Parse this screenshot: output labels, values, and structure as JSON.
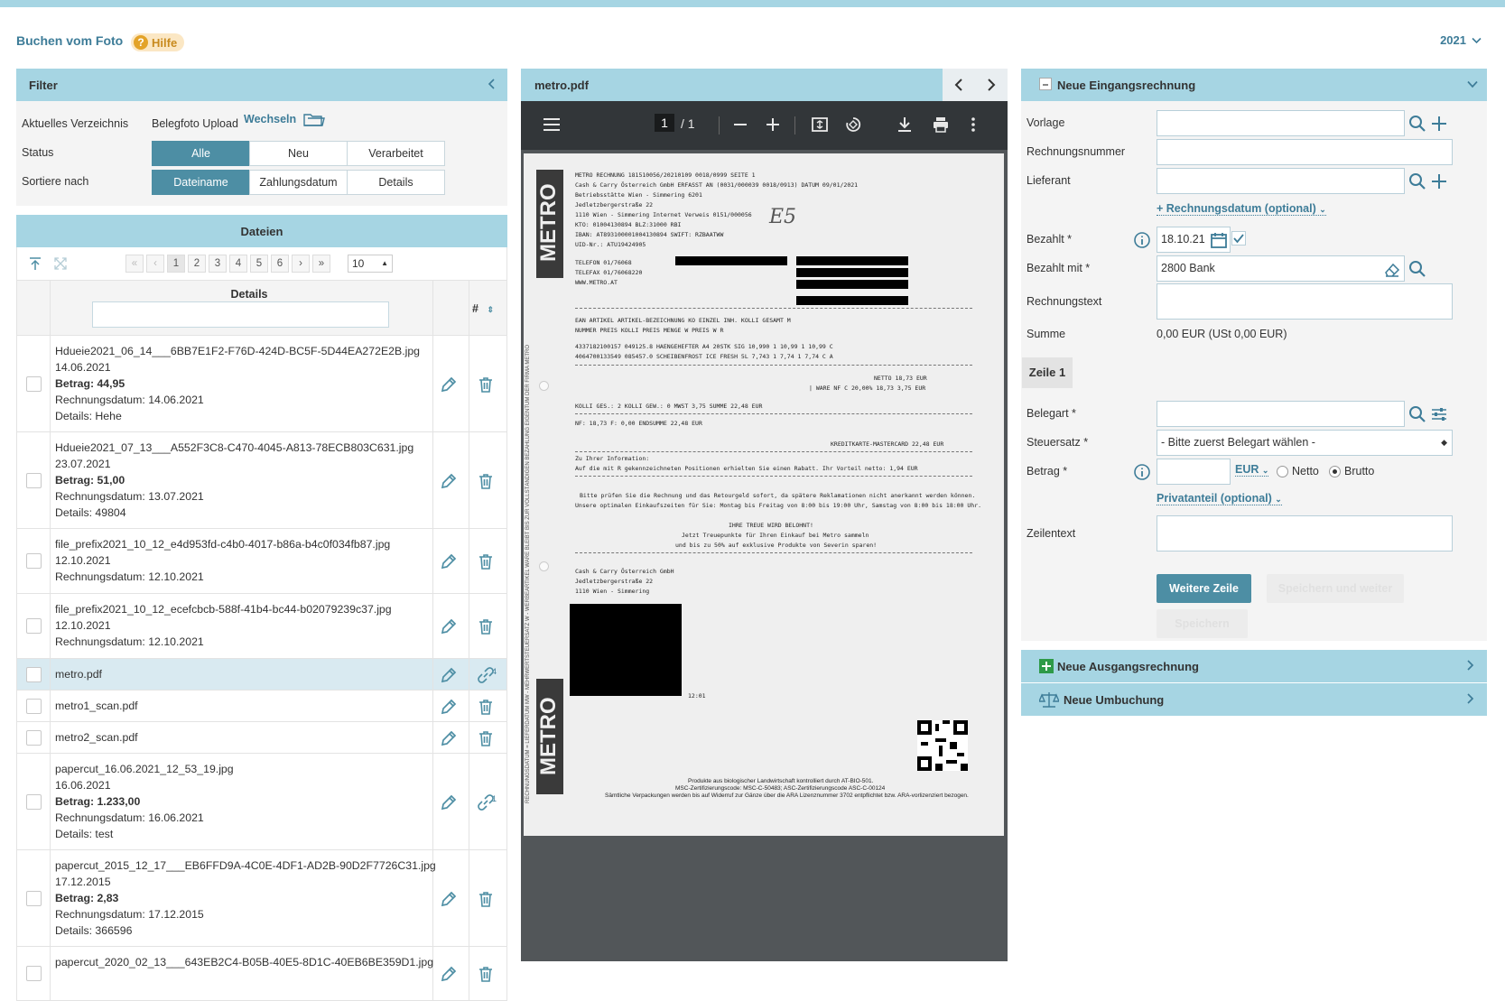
{
  "header": {
    "title": "Buchen vom Foto",
    "help_label": "Hilfe",
    "year": "2021"
  },
  "filter": {
    "title": "Filter",
    "directory_label": "Aktuelles Verzeichnis",
    "directory_value": "Belegfoto Upload",
    "change_link": "Wechseln",
    "status_label": "Status",
    "status_options": [
      "Alle",
      "Neu",
      "Verarbeitet"
    ],
    "status_selected": "Alle",
    "sort_label": "Sortiere nach",
    "sort_options": [
      "Dateiname",
      "Zahlungsdatum",
      "Details"
    ],
    "sort_selected": "Dateiname"
  },
  "files": {
    "title": "Dateien",
    "pages": [
      "1",
      "2",
      "3",
      "4",
      "5",
      "6"
    ],
    "current_page": "1",
    "page_size": "10",
    "col_details": "Details",
    "col_hash": "#",
    "rows": [
      {
        "lines": [
          "Hdueie2021_06_14___6BB7E1F2-F76D-424D-BC5F-5D44EA272E2B.jpg",
          "14.06.2021",
          "Betrag: 44,95",
          "Rechnungsdatum: 14.06.2021",
          "Details: Hehe"
        ],
        "bold_line": 2,
        "action": "delete",
        "selected": false
      },
      {
        "lines": [
          "Hdueie2021_07_13___A552F3C8-C470-4045-A813-78ECB803C631.jpg",
          "23.07.2021",
          "Betrag: 51,00",
          "Rechnungsdatum: 13.07.2021",
          "Details: 49804"
        ],
        "bold_line": 2,
        "action": "delete",
        "selected": false
      },
      {
        "lines": [
          "file_prefix2021_10_12_e4d953fd-c4b0-4017-b86a-b4c0f034fb87.jpg",
          "12.10.2021",
          "Rechnungsdatum: 12.10.2021"
        ],
        "bold_line": -1,
        "action": "delete",
        "selected": false
      },
      {
        "lines": [
          "file_prefix2021_10_12_ecefcbcb-588f-41b4-bc44-b02079239c37.jpg",
          "12.10.2021",
          "Rechnungsdatum: 12.10.2021"
        ],
        "bold_line": -1,
        "action": "delete",
        "selected": false
      },
      {
        "lines": [
          "metro.pdf"
        ],
        "bold_line": -1,
        "action": "link",
        "link_count": "4",
        "selected": true
      },
      {
        "lines": [
          "metro1_scan.pdf"
        ],
        "bold_line": -1,
        "action": "delete",
        "selected": false
      },
      {
        "lines": [
          "metro2_scan.pdf"
        ],
        "bold_line": -1,
        "action": "delete",
        "selected": false
      },
      {
        "lines": [
          "papercut_16.06.2021_12_53_19.jpg",
          "16.06.2021",
          "Betrag: 1.233,00",
          "Rechnungsdatum: 16.06.2021",
          "Details: test"
        ],
        "bold_line": 2,
        "action": "link",
        "link_count": "1",
        "selected": false
      },
      {
        "lines": [
          "papercut_2015_12_17___EB6FFD9A-4C0E-4DF1-AD2B-90D2F7726C31.jpg",
          "17.12.2015",
          "Betrag: 2,83",
          "Rechnungsdatum: 17.12.2015",
          "Details: 366596"
        ],
        "bold_line": 2,
        "action": "delete",
        "selected": false
      },
      {
        "lines": [
          "papercut_2020_02_13___643EB2C4-B05B-40E5-8D1C-40EB6BE359D1.jpg"
        ],
        "bold_line": -1,
        "action": "delete",
        "selected": false
      }
    ]
  },
  "pdf": {
    "filename": "metro.pdf",
    "page_current": "1",
    "page_total": "/ 1",
    "receipt": {
      "brand": "METRO",
      "company": "Cash & Carry Österreich GmbH",
      "lines_top": [
        "METRO                    RECHNUNG        181510056/20210109   0018/0999    SEITE  1",
        "Cash & Carry Österreich GmbH    ERFASST AN (0031/000039 0018/0913)        DATUM 09/01/2021",
        "Betriebsstätte Wien - Simmering                                                      6201",
        "Jedletzbergerstraße 22",
        "1110 Wien - Simmering                                   Internet Verweis  0151/000056",
        "KTO: 01004130894  BLZ:31000  RBI",
        "IBAN:  AT893100001004130894  SWIFT: RZBAATWW",
        "UID-Nr.: ATU19424905"
      ],
      "phone": "TELEFON 01/76068",
      "fax": "TELEFAX 01/76068220",
      "web": "WWW.METRO.AT",
      "handwritten": "E5",
      "table_header": "EAN             ARTIKEL     ARTIKEL-BEZEICHNUNG        KO    EINZEL  INH.   KOLLI           GESAMT  M",
      "table_header2": "                NUMMER                                     PREIS KOLLI  PREIS  MENGE W    PREIS  W R",
      "items": [
        "4337182100157   049125.8    HAENGEHEFTER A4 20STK SIG         10,990    1    10,99     1     10,99  C",
        "4064700133549   085457.0    SCHEIBENFROST ICE FRESH 5L         7,743    1     7,74     1      7,74  C A"
      ],
      "netto": "NETTO        18,73  EUR",
      "ware": "| WARE NF C 20,00%       18,73         3,75  EUR",
      "kolli": "KOLLI GES.: 2     KOLLI GEW.: 0                 MWST    3,75        SUMME       22,48  EUR",
      "nf": "NF:      18,73   F:       0,00                                 ENDSUMME        22,48  EUR",
      "kredit": "KREDITKARTE-MASTERCARD       22,48  EUR",
      "info1": "Zu Ihrer Information:",
      "info2": "Auf die mit R gekennzeichneten Positionen erhielten Sie einen Rabatt.     Ihr Vorteil netto:    1,94  EUR",
      "note1": "Bitte prüfen Sie die Rechnung und das Retourgeld sofort, da spätere Reklamationen nicht anerkannt werden können.",
      "note2": "Unsere optimalen Einkaufszeiten für Sie: Montag bis Freitag von 8:00 bis 19:00 Uhr, Samstag von 8:00 bis 18:00 Uhr.",
      "thanks1": "IHRE TREUE WIRD BELOHNT!",
      "thanks2": "Jetzt Treuepunkte für Ihren Einkauf bei Metro sammeln",
      "thanks3": "und bis zu 50% auf exklusive Produkte von Severin sparen!",
      "addr1": "Cash & Carry Österreich GmbH",
      "addr2": "Jedletzbergerstraße 22",
      "addr3": "1110 Wien - Simmering",
      "time": "12:01",
      "footer1": "Produkte aus biologischer Landwirtschaft kontrolliert durch AT-BIO-501.",
      "footer2": "MSC-Zertifizierungscode: MSC-C-50483; ASC-Zertifizierungscode ASC-C-00124",
      "footer3": "Sämtliche Verpackungen werden bis auf Widerruf zur Gänze über die ARA Lizenznummer 3702 entpflichtet bzw. ARA-vorlizenziert bezogen."
    }
  },
  "form": {
    "title": "Neue Eingangsrechnung",
    "vorlage_label": "Vorlage",
    "rechnungsnummer_label": "Rechnungsnummer",
    "lieferant_label": "Lieferant",
    "rechnungsdatum_link": "+ Rechnungsdatum (optional)",
    "bezahlt_label": "Bezahlt *",
    "bezahlt_value": "18.10.21",
    "bezahlt_mit_label": "Bezahlt mit *",
    "bezahlt_mit_value": "2800 Bank",
    "rechnungstext_label": "Rechnungstext",
    "summe_label": "Summe",
    "summe_value": "0,00 EUR  (USt 0,00 EUR)",
    "zeile_tab": "Zeile 1",
    "belegart_label": "Belegart *",
    "steuersatz_label": "Steuersatz *",
    "steuersatz_value": "- Bitte zuerst Belegart wählen -",
    "betrag_label": "Betrag *",
    "currency": "EUR",
    "netto_label": "Netto",
    "brutto_label": "Brutto",
    "brutto_selected": true,
    "privatanteil_link": "Privatanteil (optional)",
    "zeilentext_label": "Zeilentext",
    "btn_weitere_zeile": "Weitere Zeile",
    "btn_speichern_weiter": "Speichern und weiter",
    "btn_speichern": "Speichern"
  },
  "sections": {
    "ausgang": "Neue Ausgangsrechnung",
    "umbuchung": "Neue Umbuchung"
  },
  "colors": {
    "accent": "#a6d5e3",
    "primary": "#4d8ea4",
    "link": "#3d7c98"
  }
}
